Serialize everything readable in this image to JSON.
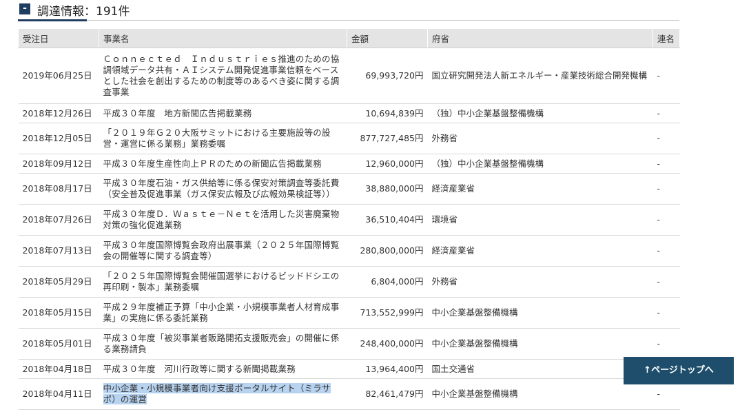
{
  "section": {
    "toggle_label": "-",
    "title": "調達情報：191件"
  },
  "table": {
    "headers": [
      "受注日",
      "事業名",
      "金額",
      "府省",
      "連名"
    ],
    "rows": [
      {
        "date": "2019年06月25日",
        "name": "Ｃｏｎｎｅｃｔｅｄ　Ｉｎｄｕｓｔｒｉｅｓ推進のための協調領域データ共有・ＡＩシステム開発促進事業信頼をベースとした社会を創出するための制度等のあるべき姿に関する調査事業",
        "amount": "69,993,720円",
        "ministry": "国立研究開発法人新エネルギー・産業技術総合開発機構",
        "joint": "-"
      },
      {
        "date": "2018年12月26日",
        "name": "平成３０年度　地方新聞広告掲載業務",
        "amount": "10,694,839円",
        "ministry": "（独）中小企業基盤整備機構",
        "joint": "-"
      },
      {
        "date": "2018年12月05日",
        "name": "「２０１９年Ｇ２０大阪サミットにおける主要施設等の設営・運営に係る業務」業務委嘱",
        "amount": "877,727,485円",
        "ministry": "外務省",
        "joint": "-"
      },
      {
        "date": "2018年09月12日",
        "name": "平成３０年度生産性向上ＰＲのための新聞広告掲載業務",
        "amount": "12,960,000円",
        "ministry": "（独）中小企業基盤整備機構",
        "joint": "-"
      },
      {
        "date": "2018年08月17日",
        "name": "平成３０年度石油・ガス供給等に係る保安対策調査等委託費（安全普及促進事業（ガス保安広報及び広報効果検証等））",
        "amount": "38,880,000円",
        "ministry": "経済産業省",
        "joint": "-"
      },
      {
        "date": "2018年07月26日",
        "name": "平成３０年度Ｄ．Ｗａｓｔｅ－Ｎｅｔを活用した災害廃棄物対策の強化促進業務",
        "amount": "36,510,404円",
        "ministry": "環境省",
        "joint": "-"
      },
      {
        "date": "2018年07月13日",
        "name": "平成３０年度国際博覧会政府出展事業（２０２５年国際博覧会の開催等に関する調査等）",
        "amount": "280,800,000円",
        "ministry": "経済産業省",
        "joint": "-"
      },
      {
        "date": "2018年05月29日",
        "name": "「２０２５年国際博覧会開催国選挙におけるビッドドシエの再印刷・製本」業務委嘱",
        "amount": "6,804,000円",
        "ministry": "外務省",
        "joint": "-"
      },
      {
        "date": "2018年05月15日",
        "name": "平成２９年度補正予算「中小企業・小規模事業者人材育成事業」の実施に係る委託業務",
        "amount": "713,552,999円",
        "ministry": "中小企業基盤整備機構",
        "joint": "-"
      },
      {
        "date": "2018年05月01日",
        "name": "平成３０年度「被災事業者販路開拓支援販売会」の開催に係る業務請負",
        "amount": "248,400,000円",
        "ministry": "中小企業基盤整備機構",
        "joint": "-"
      },
      {
        "date": "2018年04月18日",
        "name": "平成３０年度　河川行政等に関する新聞掲載業務",
        "amount": "13,964,400円",
        "ministry": "国土交通省",
        "joint": "-"
      },
      {
        "date": "2018年04月11日",
        "name": "中小企業・小規模事業者向け支援ポータルサイト（ミラサポ）の運営",
        "amount": "82,461,479円",
        "ministry": "中小企業基盤整備機構",
        "joint": "-"
      }
    ]
  },
  "page_top_button": "↑ページトップへ",
  "colors": {
    "accent": "#1f3d60",
    "header_bg": "#e4e4e4",
    "pagetop_bg": "#1f4e6c",
    "selection": "#b7d3ef"
  }
}
